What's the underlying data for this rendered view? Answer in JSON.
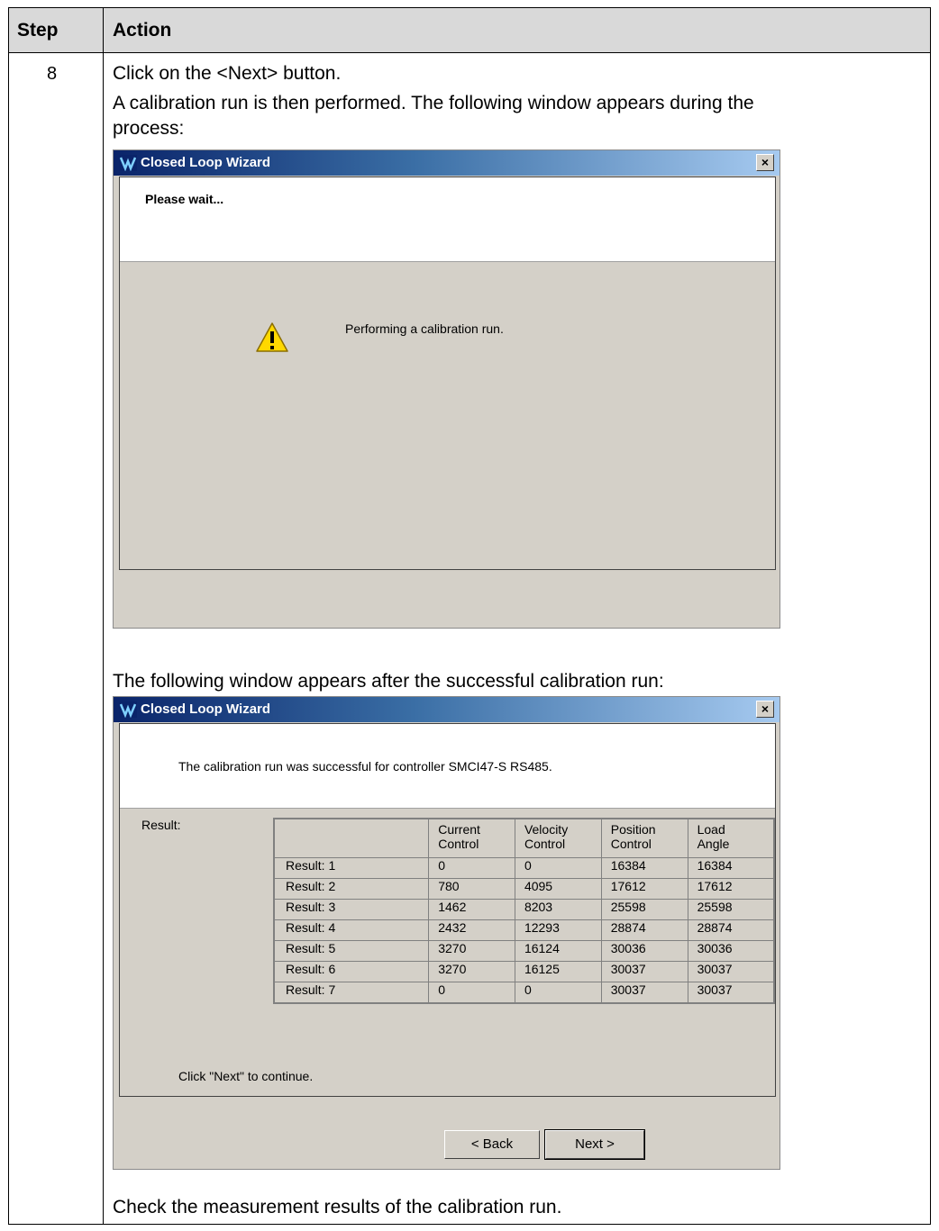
{
  "doc": {
    "header": {
      "step": "Step",
      "action": "Action"
    },
    "step_number": "8",
    "line1": "Click on the <Next> button.",
    "line2": "A calibration run is then performed. The following window appears during the",
    "line3": "process:",
    "line4": "The following window appears after the successful calibration run:",
    "line5": "Check the measurement results of the calibration run."
  },
  "dialog1": {
    "title": "Closed Loop Wizard",
    "heading": "Please wait...",
    "message": "Performing a calibration run.",
    "close_label": "×",
    "warning_icon": "warning-icon"
  },
  "dialog2": {
    "title": "Closed Loop Wizard",
    "message": "The calibration run was successful for controller SMCI47-S RS485.",
    "result_label": "Result:",
    "footer_text": "Click \"Next\" to continue.",
    "back_label": "< Back",
    "next_label": "Next >",
    "close_label": "×",
    "columns": [
      [
        "Current",
        "Control"
      ],
      [
        "Velocity",
        "Control"
      ],
      [
        "Position",
        "Control"
      ],
      [
        "Load",
        "Angle"
      ]
    ],
    "rows": [
      {
        "label": "Result: 1",
        "values": [
          "0",
          "0",
          "16384",
          "16384"
        ]
      },
      {
        "label": "Result: 2",
        "values": [
          "780",
          "4095",
          "17612",
          "17612"
        ]
      },
      {
        "label": "Result: 3",
        "values": [
          "1462",
          "8203",
          "25598",
          "25598"
        ]
      },
      {
        "label": "Result: 4",
        "values": [
          "2432",
          "12293",
          "28874",
          "28874"
        ]
      },
      {
        "label": "Result: 5",
        "values": [
          "3270",
          "16124",
          "30036",
          "30036"
        ]
      },
      {
        "label": "Result: 6",
        "values": [
          "3270",
          "16125",
          "30037",
          "30037"
        ]
      },
      {
        "label": "Result: 7",
        "values": [
          "0",
          "0",
          "30037",
          "30037"
        ]
      }
    ]
  }
}
